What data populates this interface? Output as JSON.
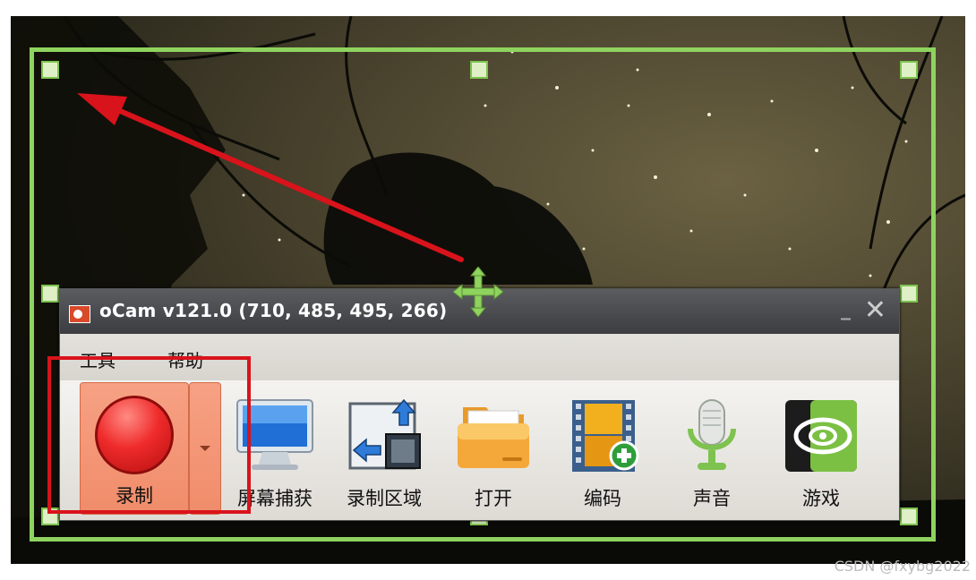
{
  "window": {
    "title": "oCam v121.0 (710, 485, 495, 266)",
    "minimize_glyph": "_",
    "close_glyph": "✕"
  },
  "menu": {
    "items": [
      {
        "label": "工具"
      },
      {
        "label": "帮助"
      }
    ]
  },
  "toolbar": {
    "record_label": "录制",
    "items": [
      {
        "label": "屏幕捕获",
        "icon": "monitor-icon"
      },
      {
        "label": "录制区域",
        "icon": "resize-region-icon"
      },
      {
        "label": "打开",
        "icon": "folder-icon"
      },
      {
        "label": "编码",
        "icon": "film-add-icon"
      },
      {
        "label": "声音",
        "icon": "microphone-icon"
      },
      {
        "label": "游戏",
        "icon": "nvidia-game-icon"
      }
    ]
  },
  "watermark": "CSDN @fxybg2022",
  "colors": {
    "selection_frame": "#8fd35f",
    "highlight_box": "#d9131b",
    "arrow": "#d9131b",
    "move_cross": "#8fd35f"
  }
}
